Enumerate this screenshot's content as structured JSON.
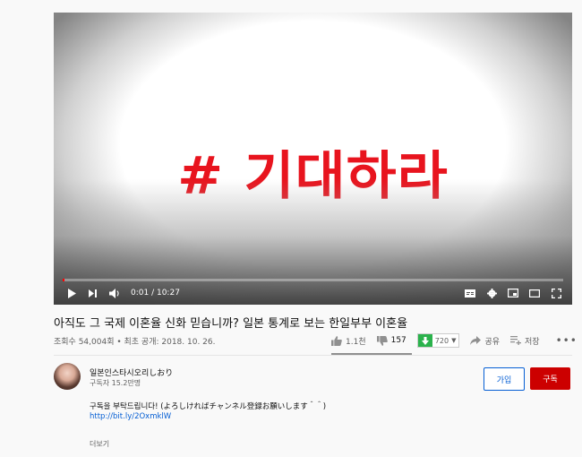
{
  "player": {
    "overlay_text": "# 기대하라",
    "time_current": "0:01",
    "time_separator": " / ",
    "time_total": "10:27",
    "progress": 0.0016,
    "accent_color": "#ff0000"
  },
  "video": {
    "title": "아직도 그 국제 이혼율 신화 믿습니까? 일본 통계로 보는 한일부부 이혼율",
    "meta": "조회수 54,004회 • 최초 공개: 2018. 10. 26."
  },
  "actions": {
    "like_count": "1.1천",
    "dislike_count": "157",
    "download_quality": "720",
    "share_label": "공유",
    "save_label": "저장",
    "more_label": "•••"
  },
  "channel": {
    "name": "일본인스타시오리しおり",
    "subscribers": "구독자 15.2만명",
    "join_label": "가입",
    "subscribe_label": "구독"
  },
  "description": {
    "line1": "구독을 부탁드립니다! (よろしければチャンネル登録お願いします＾＾)",
    "link": "http://bit.ly/2OxmklW",
    "show_more": "더보기"
  }
}
